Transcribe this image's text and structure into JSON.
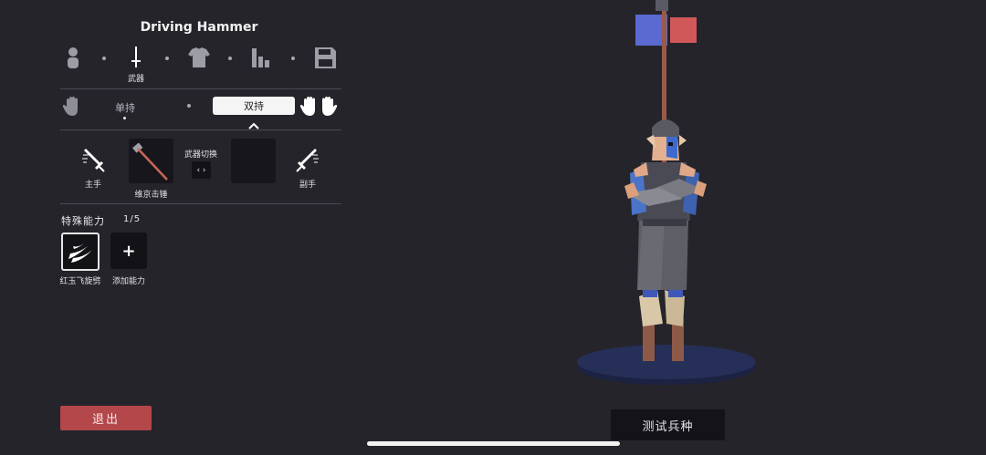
{
  "unit_name": "Driving Hammer",
  "categories": [
    {
      "icon": "person-icon",
      "label": ""
    },
    {
      "icon": "sword-icon",
      "label": "武器"
    },
    {
      "icon": "shirt-icon",
      "label": ""
    },
    {
      "icon": "stats-icon",
      "label": ""
    },
    {
      "icon": "save-icon",
      "label": ""
    }
  ],
  "hands": {
    "single_label": "单持",
    "dual_label": "双持",
    "selected": "双持"
  },
  "weapons": {
    "main_label": "主手",
    "off_label": "副手",
    "switch_label": "武器切换",
    "switch_symbol": "‹ ›",
    "main_weapon_name": "维京击锤"
  },
  "abilities": {
    "title": "特殊能力",
    "count": "1/5",
    "items": [
      {
        "name": "红玉飞旋劈",
        "icon": "slash-ability-icon"
      }
    ],
    "add_label": "添加能力",
    "add_symbol": "+"
  },
  "buttons": {
    "quit": "退出",
    "test": "测试兵种"
  },
  "colors": {
    "background": "#25242b",
    "quit_button": "#b3474a",
    "banner_blue": "#5a6ad0",
    "banner_red": "#d05858"
  }
}
